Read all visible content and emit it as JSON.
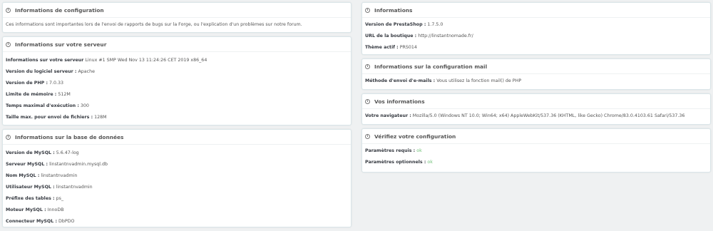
{
  "left": {
    "config": {
      "title": "Informations de configuration",
      "text": "Ces informations sont importantes lors de l'envoi de rapports de bugs sur la Forge, ou l'explication d'un problèmes sur notre forum."
    },
    "server": {
      "title": "Informations sur votre serveur",
      "rows": [
        {
          "label": "Informations sur votre serveur",
          "value": "Linux #1 SMP Wed Nov 13 11:24:26 CET 2019 x86_64"
        },
        {
          "label": "Version du logiciel serveur :",
          "value": "Apache"
        },
        {
          "label": "Version de PHP :",
          "value": "7.0.33"
        },
        {
          "label": "Limite de mémoire :",
          "value": "512M"
        },
        {
          "label": "Temps maximal d'exécution :",
          "value": "300"
        },
        {
          "label": "Taille max. pour envoi de fichiers :",
          "value": "128M"
        }
      ]
    },
    "db": {
      "title": "Informations sur la base de données",
      "rows": [
        {
          "label": "Version de MySQL :",
          "value": "5.6.47-log"
        },
        {
          "label": "Serveur MySQL :",
          "value": "linstantnvadmin.mysql.db"
        },
        {
          "label": "Nom MySQL :",
          "value": "linstantnvadmin"
        },
        {
          "label": "Utilisateur MySQL :",
          "value": "linstantnvadmin"
        },
        {
          "label": "Préfixe des tables :",
          "value": "ps_"
        },
        {
          "label": "Moteur MySQL :",
          "value": "InnoDB"
        },
        {
          "label": "Connecteur MySQL :",
          "value": "DbPDO"
        }
      ]
    }
  },
  "right": {
    "info": {
      "title": "Informations",
      "rows": [
        {
          "label": "Version de PrestaShop :",
          "value": "1.7.5.0"
        },
        {
          "label": "URL de la boutique :",
          "value": "http://linstantnomade.fr/"
        },
        {
          "label": "Thème actif :",
          "value": "PRS014"
        }
      ]
    },
    "mail": {
      "title": "Informations sur la configuration mail",
      "rows": [
        {
          "label": "Méthode d'envoi d'e-mails :",
          "value": "Vous utilisez la fonction mail() de PHP"
        }
      ]
    },
    "you": {
      "title": "Vos informations",
      "rows": [
        {
          "label": "Votre navigateur :",
          "value": "Mozilla/5.0 (Windows NT 10.0; Win64; x64) AppleWebKit/537.36 (KHTML, like Gecko) Chrome/83.0.4103.61 Safari/537.36"
        }
      ]
    },
    "check": {
      "title": "Vérifiez votre configuration",
      "rows": [
        {
          "label": "Paramètres requis :",
          "value": "ok"
        },
        {
          "label": "Paramètres optionnels :",
          "value": "ok"
        }
      ]
    }
  },
  "icons": {
    "info": "info-circle-icon",
    "glyph": "i"
  },
  "colors": {
    "background": "#eff1f2",
    "ok": "#72c279",
    "text": "#363a41"
  }
}
